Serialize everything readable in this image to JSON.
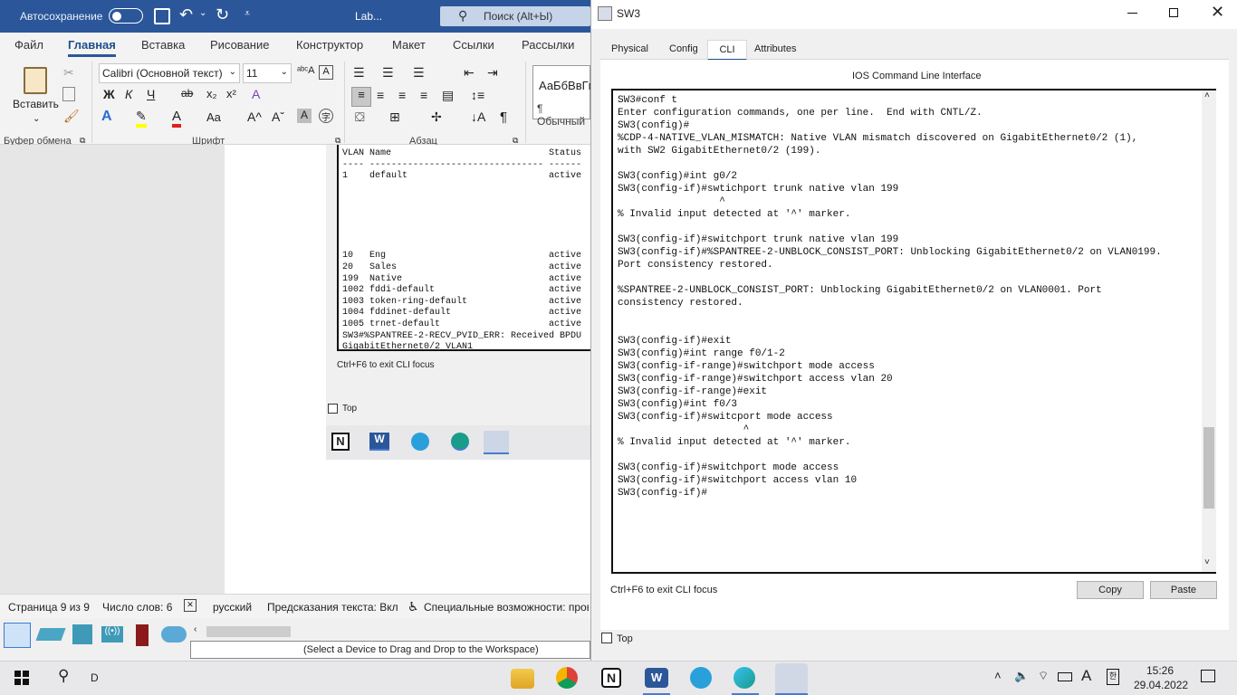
{
  "word": {
    "autosave_label": "Автосохранение",
    "doc_name": "Lab...",
    "search_placeholder": "Поиск (Alt+Ы)",
    "tabs": [
      "Файл",
      "Главная",
      "Вставка",
      "Рисование",
      "Конструктор",
      "Макет",
      "Ссылки",
      "Рассылки"
    ],
    "paste_label": "Вставить",
    "font_name": "Calibri (Основной текст)",
    "font_size": "11",
    "styles_preview": "АаБбВвГг",
    "styles_name": "¶ Обычный",
    "groups": {
      "clipboard": "Буфер обмена",
      "font": "Шрифт",
      "paragraph": "Абзац"
    },
    "doc_terminal_lines": [
      "VLAN Name                             Status",
      "---- -------------------------------- ------",
      "1    default                          active",
      "",
      "",
      "",
      "",
      "",
      "",
      "10   Eng                              active",
      "20   Sales                            active",
      "199  Native                           active",
      "1002 fddi-default                     active",
      "1003 token-ring-default               active",
      "1004 fddinet-default                  active",
      "1005 trnet-default                    active",
      "SW3#%SPANTREE-2-RECV_PVID_ERR: Received BPDU",
      "GigabitEthernet0/2 VLAN1"
    ],
    "doc_hint": "Ctrl+F6 to exit CLI focus",
    "doc_top_label": "Top",
    "status": {
      "page": "Страница 9 из 9",
      "words": "Число слов: 6",
      "lang": "русский",
      "predict": "Предсказания текста: Вкл",
      "access": "Специальные возможности: пров"
    }
  },
  "pt": {
    "title": "SW3",
    "tabs": [
      "Physical",
      "Config",
      "CLI",
      "Attributes"
    ],
    "active_tab": "CLI",
    "heading": "IOS Command Line Interface",
    "cli_lines": [
      "SW3#conf t",
      "Enter configuration commands, one per line.  End with CNTL/Z.",
      "SW3(config)#",
      "%CDP-4-NATIVE_VLAN_MISMATCH: Native VLAN mismatch discovered on GigabitEthernet0/2 (1),",
      "with SW2 GigabitEthernet0/2 (199).",
      "",
      "SW3(config)#int g0/2",
      "SW3(config-if)#swtichport trunk native vlan 199",
      "                 ^",
      "% Invalid input detected at '^' marker.",
      "",
      "SW3(config-if)#switchport trunk native vlan 199",
      "SW3(config-if)#%SPANTREE-2-UNBLOCK_CONSIST_PORT: Unblocking GigabitEthernet0/2 on VLAN0199.",
      "Port consistency restored.",
      "",
      "%SPANTREE-2-UNBLOCK_CONSIST_PORT: Unblocking GigabitEthernet0/2 on VLAN0001. Port",
      "consistency restored.",
      "",
      "",
      "SW3(config-if)#exit",
      "SW3(config)#int range f0/1-2",
      "SW3(config-if-range)#switchport mode access",
      "SW3(config-if-range)#switchport access vlan 20",
      "SW3(config-if-range)#exit",
      "SW3(config)#int f0/3",
      "SW3(config-if)#switcport mode access",
      "                     ^",
      "% Invalid input detected at '^' marker.",
      "",
      "SW3(config-if)#switchport mode access",
      "SW3(config-if)#switchport access vlan 10",
      "SW3(config-if)#"
    ],
    "hint": "Ctrl+F6 to exit CLI focus",
    "copy_label": "Copy",
    "paste_label": "Paste",
    "top_label": "Top",
    "drag_hint": "(Select a Device to Drag and Drop to the Workspace)"
  },
  "taskbar": {
    "search_text": "D",
    "time": "15:26",
    "date": "29.04.2022",
    "lang_icon": "A"
  }
}
